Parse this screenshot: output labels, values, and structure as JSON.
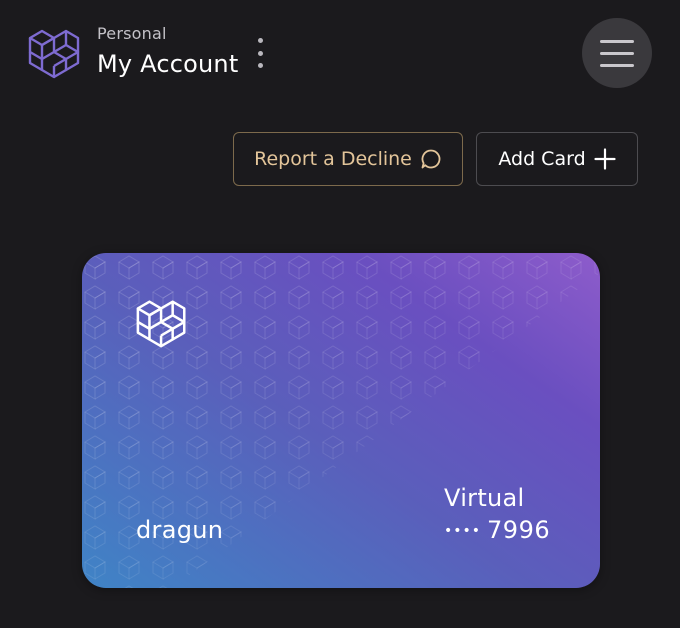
{
  "header": {
    "account_type": "Personal",
    "account_name": "My Account",
    "logo_icon": "cube-logo-icon",
    "more_icon": "kebab-menu-icon",
    "menu_icon": "hamburger-menu-icon"
  },
  "actions": {
    "report_decline_label": "Report a Decline",
    "report_decline_icon": "chat-bubble-icon",
    "add_card_label": "Add Card",
    "add_card_icon": "plus-icon"
  },
  "card": {
    "holder_name": "dragun",
    "card_type": "Virtual",
    "mask": "••••",
    "last_four": "7996",
    "logo_icon": "cube-logo-icon"
  },
  "colors": {
    "background": "#1b1a1d",
    "decline_accent": "#e3c59a",
    "logo_purple": "#7e6bd1",
    "card_gradient_start": "#3f84c6",
    "card_gradient_end": "#8e5ccb"
  }
}
